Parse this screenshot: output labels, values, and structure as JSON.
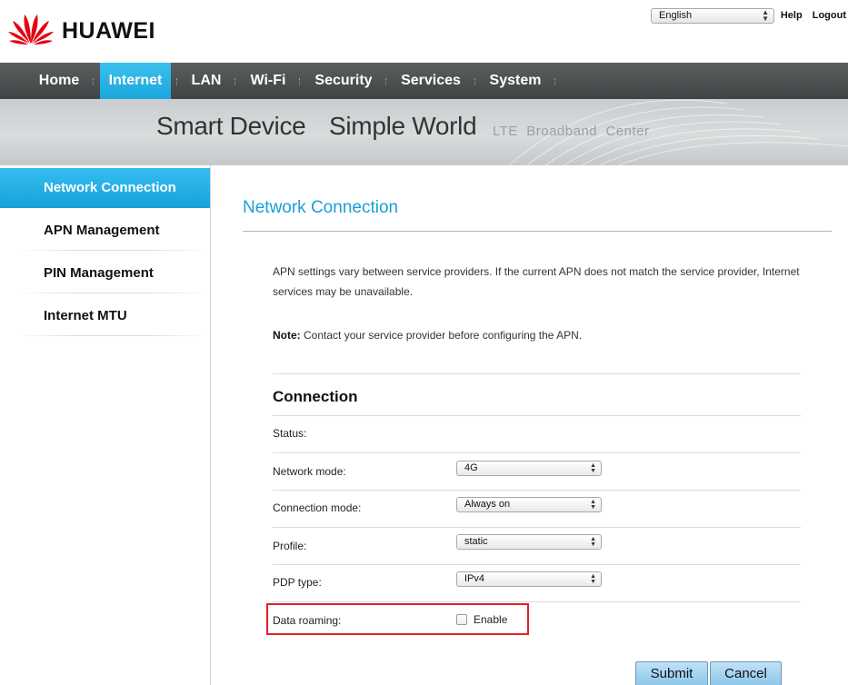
{
  "header": {
    "brand": "HUAWEI",
    "language": "English",
    "help": "Help",
    "logout": "Logout",
    "brand_color": "#e60012"
  },
  "nav": {
    "items": [
      {
        "label": "Home"
      },
      {
        "label": "Internet",
        "active": true
      },
      {
        "label": "LAN"
      },
      {
        "label": "Wi-Fi"
      },
      {
        "label": "Security"
      },
      {
        "label": "Services"
      },
      {
        "label": "System"
      }
    ],
    "active_color": "#1aa7dc"
  },
  "banner": {
    "text1": "Smart Device",
    "text2": "Simple World",
    "text3": "LTE  Broadband  Center"
  },
  "sidebar": {
    "items": [
      {
        "label": "Network Connection",
        "active": true
      },
      {
        "label": "APN Management"
      },
      {
        "label": "PIN Management"
      },
      {
        "label": "Internet MTU"
      }
    ]
  },
  "main": {
    "title": "Network Connection",
    "description": "APN settings vary between service providers. If the current APN does not match the service provider, Internet services may be unavailable.",
    "note_label": "Note:",
    "note_text": " Contact your service provider before configuring the APN.",
    "section_title": "Connection",
    "fields": {
      "status": {
        "label": "Status:"
      },
      "network_mode": {
        "label": "Network mode:",
        "value": "4G"
      },
      "connection_mode": {
        "label": "Connection mode:",
        "value": "Always on"
      },
      "profile": {
        "label": "Profile:",
        "value": "static"
      },
      "pdp_type": {
        "label": "PDP type:",
        "value": "IPv4"
      },
      "data_roaming": {
        "label": "Data roaming:",
        "option": "Enable",
        "checked": false
      }
    },
    "submit_label": "Submit",
    "cancel_label": "Cancel",
    "highlight_color": "#e0202a"
  }
}
